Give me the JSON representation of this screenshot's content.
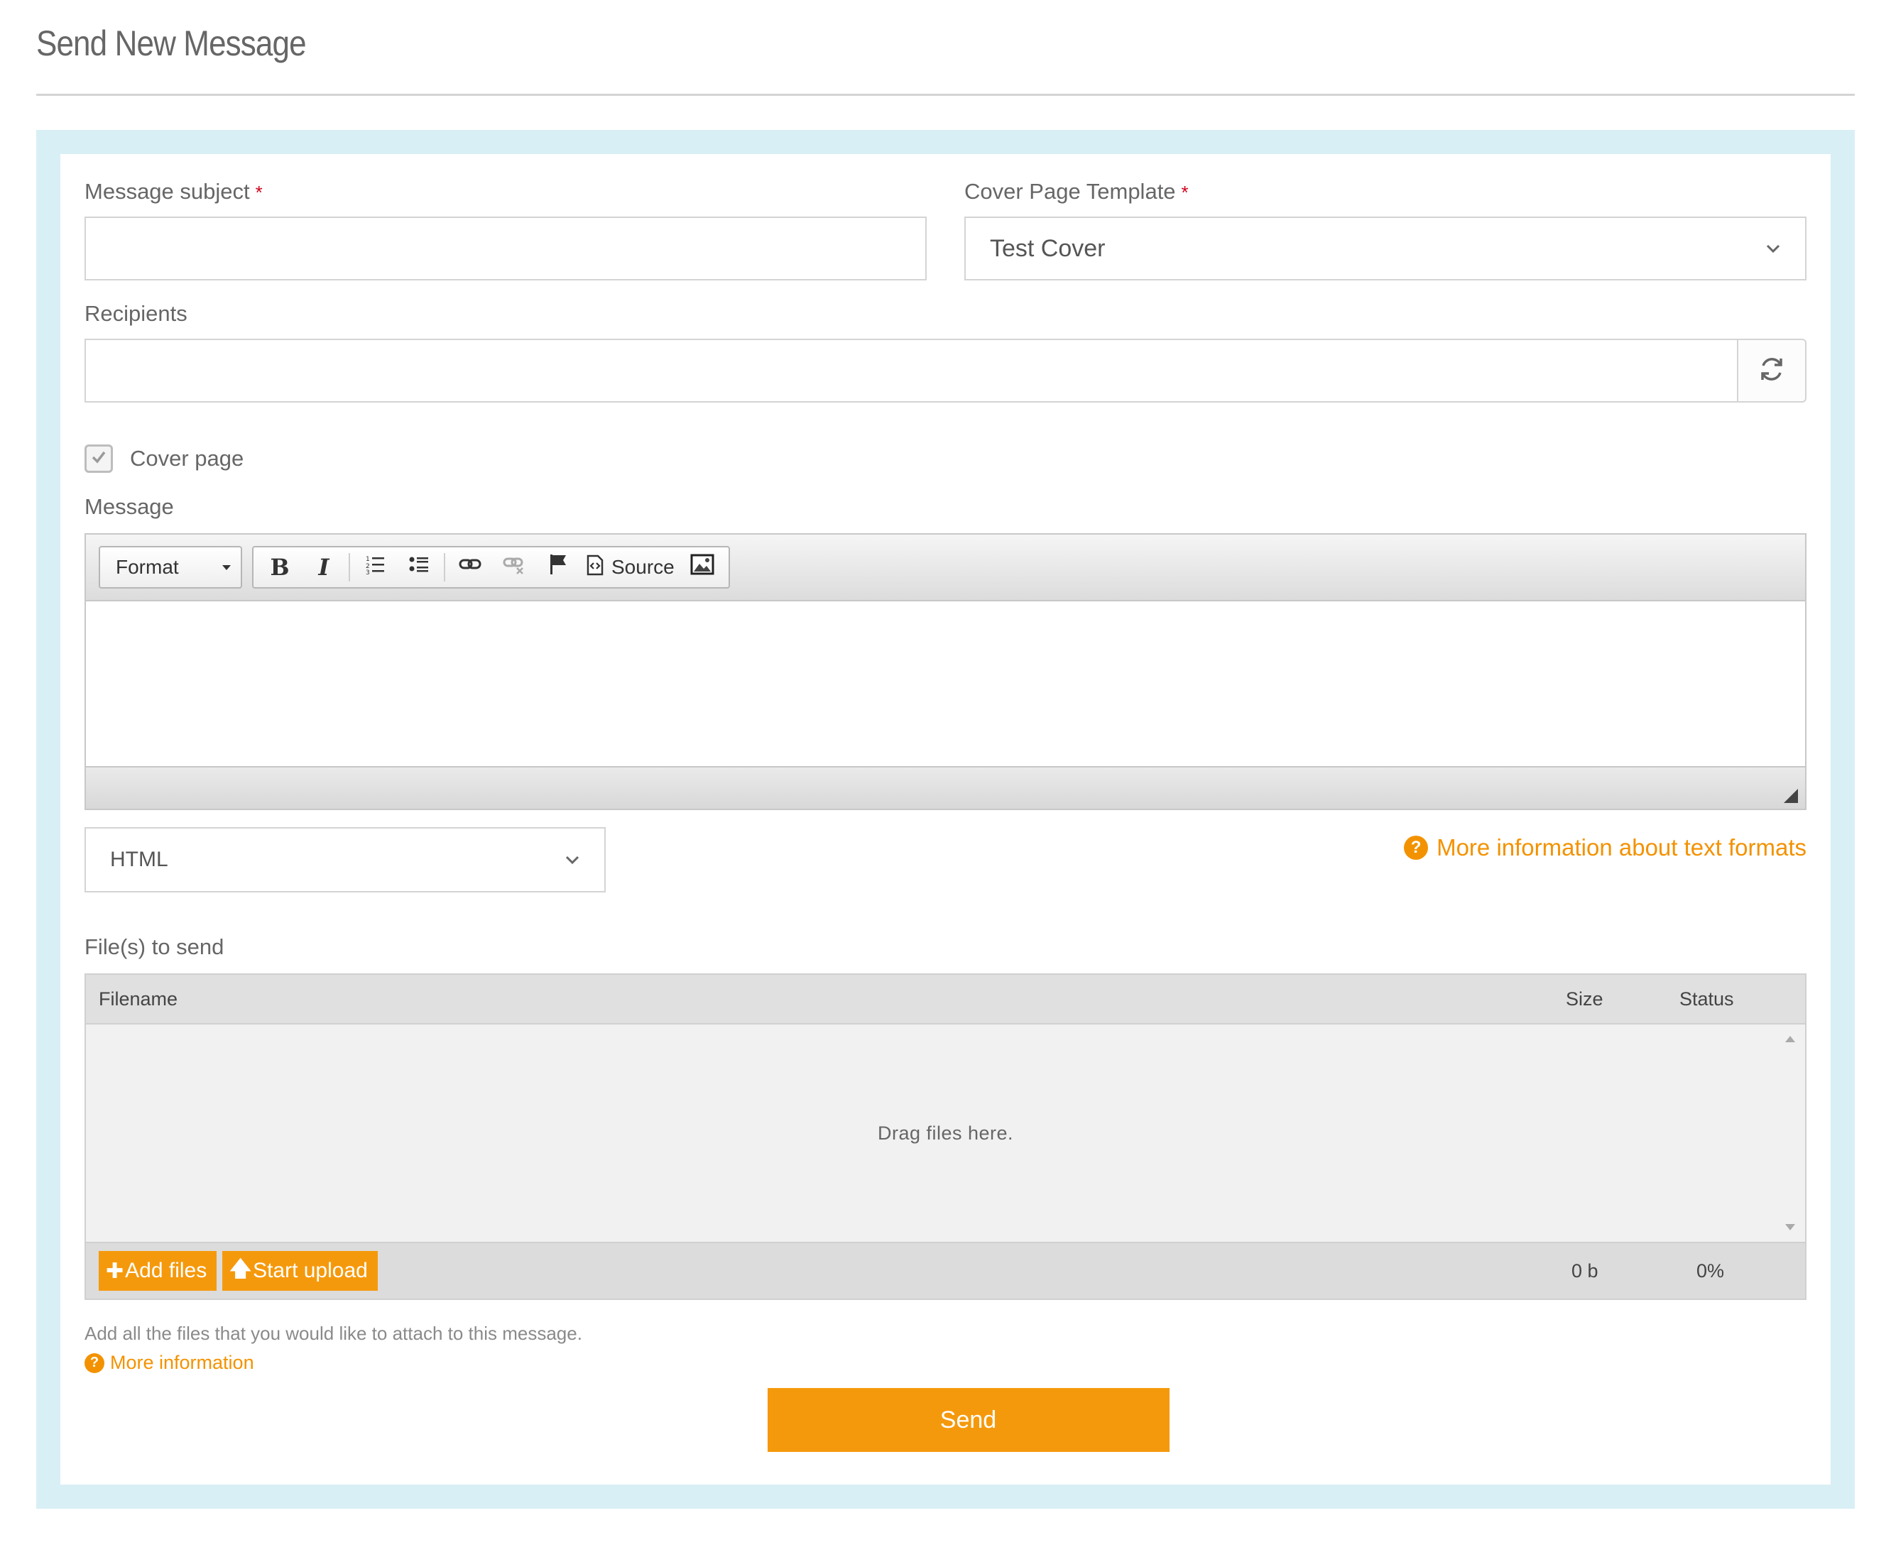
{
  "page": {
    "title": "Send New Message"
  },
  "form": {
    "subject": {
      "label": "Message subject",
      "required_mark": "*",
      "value": "",
      "placeholder": ""
    },
    "cover_template": {
      "label": "Cover Page Template",
      "required_mark": "*",
      "selected": "Test Cover"
    },
    "recipients": {
      "label": "Recipients",
      "value": "",
      "placeholder": "",
      "refresh_icon": "refresh-icon"
    },
    "cover_page": {
      "label": "Cover page",
      "checked": true
    },
    "message": {
      "label": "Message",
      "toolbar": {
        "format_label": "Format",
        "source_label": "Source",
        "buttons": [
          "bold",
          "italic",
          "numbered-list",
          "bulleted-list",
          "link",
          "unlink",
          "anchor",
          "source",
          "image"
        ]
      },
      "body": ""
    },
    "text_format": {
      "selected": "HTML",
      "more_info_label": "More information about text formats"
    },
    "files": {
      "label": "File(s) to send",
      "columns": {
        "filename": "Filename",
        "size": "Size",
        "status": "Status"
      },
      "drop_text": "Drag files here.",
      "add_files_label": "Add files",
      "start_upload_label": "Start upload",
      "total_size": "0 b",
      "total_status": "0%",
      "hint": "Add all the files that you would like to attach to this message.",
      "more_info_label": "More information"
    },
    "send_label": "Send"
  },
  "colors": {
    "accent": "#f5990c",
    "panel_border": "#d8eff5",
    "required": "#d0021b"
  }
}
